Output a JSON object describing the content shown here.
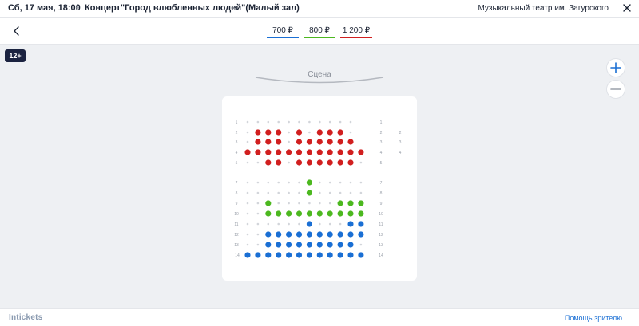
{
  "header": {
    "event_date": "Сб, 17 мая, 18:00",
    "separator": "•",
    "event_title": "Концерт\"Город влюбленных людей\"(Малый зал)",
    "venue": "Музыкальный театр им. Загурского"
  },
  "prices": [
    {
      "label": "700 ₽",
      "color": "#1a6fd4"
    },
    {
      "label": "800 ₽",
      "color": "#4cb81f"
    },
    {
      "label": "1 200 ₽",
      "color": "#d11f1f"
    }
  ],
  "age_badge": "12+",
  "stage": {
    "label": "Сцена"
  },
  "seating": {
    "colors": {
      "red": "#d11f1f",
      "green": "#4cb81f",
      "blue": "#1a6fd4",
      "empty": "#d2d5da",
      "numbers": "#9aa0aa"
    },
    "rows": [
      {
        "row": 1,
        "right_label": "1",
        "seats": "...........",
        "far_label": ""
      },
      {
        "row": 2,
        "right_label": "2",
        "seats": ".RRR.R.RRR.",
        "far_label": "2"
      },
      {
        "row": 3,
        "right_label": "3",
        "seats": ".RRR.RRRRRR",
        "far_label": "3"
      },
      {
        "row": 4,
        "right_label": "4",
        "seats": "RRRRRRRRRRRR",
        "far_label": "4"
      },
      {
        "row": 5,
        "right_label": "5",
        "seats": "..RR.RRRRRR.",
        "far_label": ""
      },
      {
        "row": 7,
        "right_label": "7",
        "seats": "......G.....",
        "far_label": ""
      },
      {
        "row": 8,
        "right_label": "8",
        "seats": "......G.....",
        "far_label": ""
      },
      {
        "row": 9,
        "right_label": "9",
        "seats": "..G......GGG",
        "far_label": ""
      },
      {
        "row": 10,
        "right_label": "10",
        "seats": "..GGGGGGGGGG",
        "far_label": ""
      },
      {
        "row": 11,
        "right_label": "11",
        "seats": "......B...BB",
        "far_label": ""
      },
      {
        "row": 12,
        "right_label": "12",
        "seats": "..BBBBBBBBBB",
        "far_label": ""
      },
      {
        "row": 13,
        "right_label": "13",
        "seats": "..BBBBBBBBB.",
        "far_label": ""
      },
      {
        "row": 14,
        "right_label": "14",
        "seats": "BBBBBBBBBBBB",
        "far_label": ""
      }
    ]
  },
  "footer": {
    "brand": "Intickets",
    "help": "Помощь зрителю"
  }
}
